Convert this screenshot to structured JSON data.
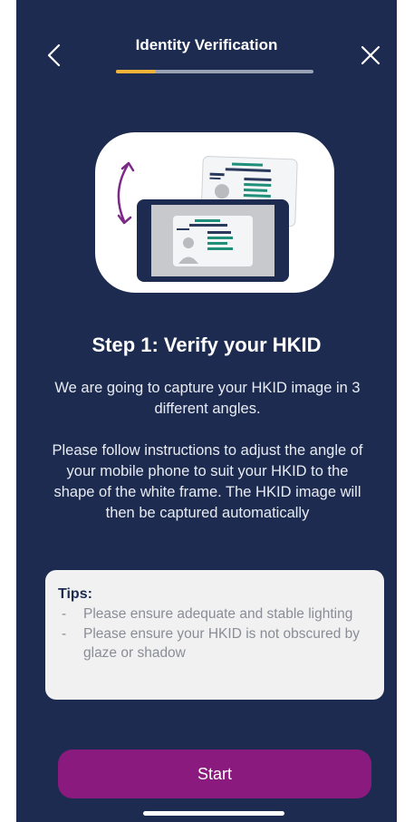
{
  "header": {
    "title": "Identity Verification",
    "back_icon": "chevron-left-icon",
    "close_icon": "close-icon",
    "progress": 0.2
  },
  "colors": {
    "background": "#1c2b4f",
    "accent": "#f2b338",
    "primary_button": "#8b1a7e",
    "card": "#f1f1f2"
  },
  "illustration": {
    "icon": "hkid-card-phone-rotation-icon"
  },
  "step": {
    "title": "Step 1: Verify your HKID",
    "description_1": "We are going to capture your HKID image in 3 different angles.",
    "description_2": "Please follow instructions to adjust the angle of your mobile phone to suit your HKID to the shape of the white frame. The HKID image will then be captured automatically"
  },
  "tips": {
    "title": "Tips:",
    "items": [
      "Please ensure adequate and stable lighting",
      "Please ensure your HKID is not obscured by glaze or shadow"
    ],
    "bullet": "-"
  },
  "start_button": {
    "label": "Start"
  }
}
